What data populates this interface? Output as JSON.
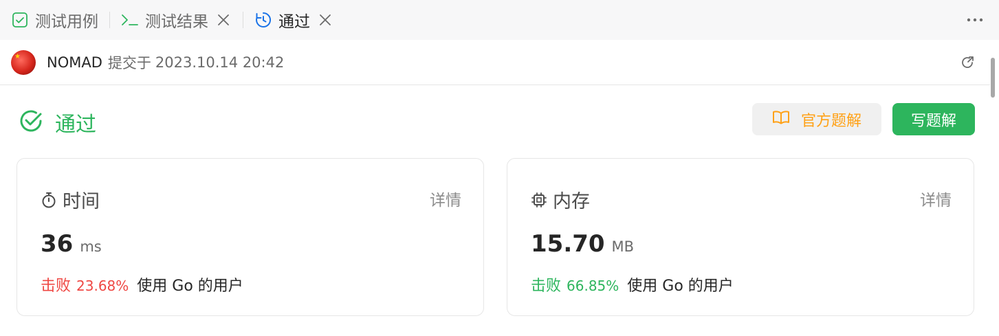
{
  "tabs": [
    {
      "label": "测试用例",
      "icon": "checkbox-icon"
    },
    {
      "label": "测试结果",
      "icon": "terminal-icon",
      "closable": true
    },
    {
      "label": "通过",
      "icon": "history-icon",
      "closable": true,
      "active": true
    }
  ],
  "submission": {
    "user": "NOMAD",
    "action": "提交于",
    "time": "2023.10.14 20:42"
  },
  "status": {
    "label": "通过",
    "color": "#2db55d"
  },
  "buttons": {
    "official_solution": "官方题解",
    "write_solution": "写题解"
  },
  "cards": {
    "time": {
      "title": "时间",
      "detail": "详情",
      "value": "36",
      "unit": "ms",
      "beat_label": "击败",
      "beat_pct": "23.68%",
      "beat_suffix": "使用 Go 的用户",
      "beat_color": "#ef4743"
    },
    "memory": {
      "title": "内存",
      "detail": "详情",
      "value": "15.70",
      "unit": "MB",
      "beat_label": "击败",
      "beat_pct": "66.85%",
      "beat_suffix": "使用 Go 的用户",
      "beat_color": "#2db55d"
    }
  },
  "colors": {
    "accent_green": "#2db55d",
    "accent_orange": "#ffa116",
    "accent_blue": "#1a73e8",
    "danger_red": "#ef4743"
  }
}
